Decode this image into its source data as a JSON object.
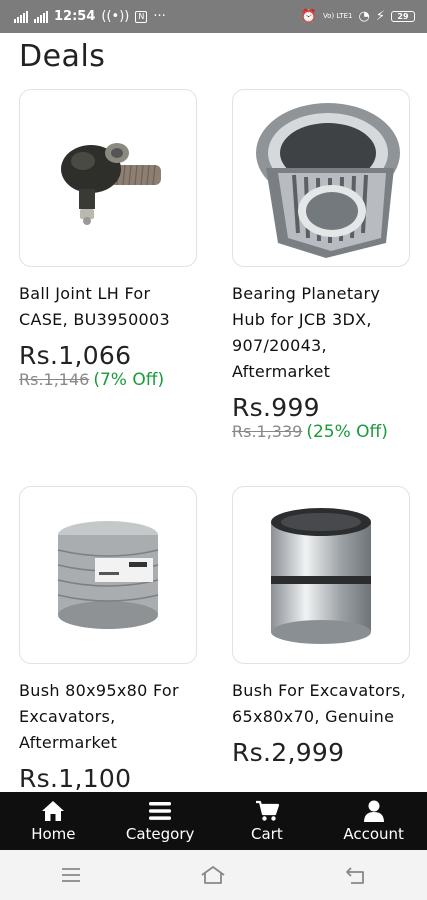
{
  "status_bar": {
    "time": "12:54",
    "battery": "29",
    "network_label": "Vo) LTE1"
  },
  "page": {
    "title": "Deals"
  },
  "products": [
    {
      "name": "Ball Joint LH For CASE, BU3950003",
      "price": "Rs.1,066",
      "mrp": "Rs.1,146",
      "discount": "(7% Off)",
      "image_icon": "ball-joint-image"
    },
    {
      "name": "Bearing Planetary Hub for JCB 3DX, 907/20043, Aftermarket",
      "price": "Rs.999",
      "mrp": "Rs.1,339",
      "discount": "(25% Off)",
      "image_icon": "bearing-image"
    },
    {
      "name": "Bush 80x95x80 For Excavators, Aftermarket",
      "price": "Rs.1,100",
      "mrp": "",
      "discount": "",
      "image_icon": "wrapped-bush-image"
    },
    {
      "name": "Bush For Excavators, 65x80x70, Genuine",
      "price": "Rs.2,999",
      "mrp": "",
      "discount": "",
      "image_icon": "metal-bush-image"
    }
  ],
  "bottom_nav": {
    "items": [
      {
        "label": "Home",
        "icon": "home-icon"
      },
      {
        "label": "Category",
        "icon": "menu-icon"
      },
      {
        "label": "Cart",
        "icon": "cart-icon"
      },
      {
        "label": "Account",
        "icon": "account-icon"
      }
    ]
  },
  "colors": {
    "discount": "#1a9b3a",
    "nav_bg": "#0f0f0f",
    "status_bg": "#7c7c7c"
  }
}
